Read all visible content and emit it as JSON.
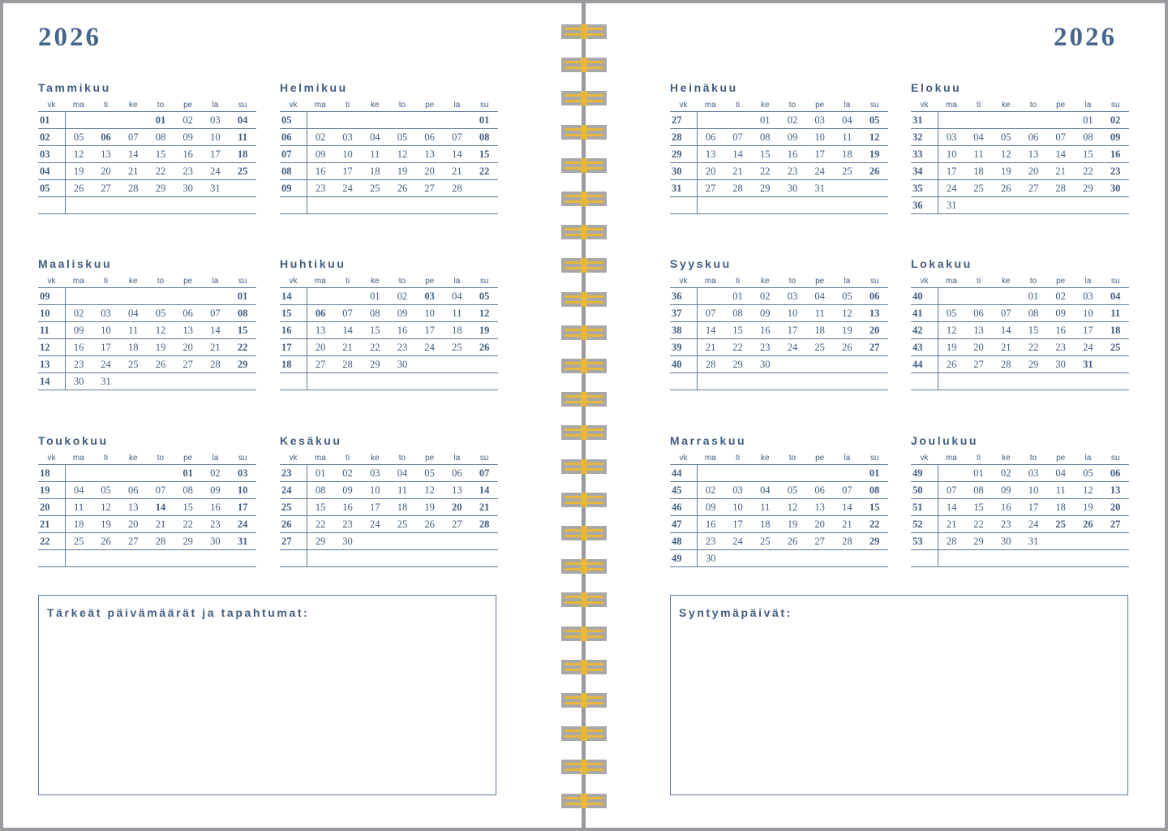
{
  "year": "2026",
  "weekday_headers": [
    "vk",
    "ma",
    "ti",
    "ke",
    "to",
    "pe",
    "la",
    "su"
  ],
  "months": [
    {
      "name": "Tammikuu",
      "rows": [
        {
          "wk": "01",
          "days": [
            "",
            "",
            "",
            "01",
            "02",
            "03",
            "04"
          ],
          "bold": [
            3,
            6
          ]
        },
        {
          "wk": "02",
          "days": [
            "05",
            "06",
            "07",
            "08",
            "09",
            "10",
            "11"
          ],
          "bold": [
            1,
            6
          ]
        },
        {
          "wk": "03",
          "days": [
            "12",
            "13",
            "14",
            "15",
            "16",
            "17",
            "18"
          ],
          "bold": [
            6
          ]
        },
        {
          "wk": "04",
          "days": [
            "19",
            "20",
            "21",
            "22",
            "23",
            "24",
            "25"
          ],
          "bold": [
            6
          ]
        },
        {
          "wk": "05",
          "days": [
            "26",
            "27",
            "28",
            "29",
            "30",
            "31",
            ""
          ],
          "bold": []
        },
        {
          "wk": "",
          "days": [
            "",
            "",
            "",
            "",
            "",
            "",
            ""
          ],
          "bold": []
        }
      ]
    },
    {
      "name": "Helmikuu",
      "rows": [
        {
          "wk": "05",
          "days": [
            "",
            "",
            "",
            "",
            "",
            "",
            "01"
          ],
          "bold": [
            6
          ]
        },
        {
          "wk": "06",
          "days": [
            "02",
            "03",
            "04",
            "05",
            "06",
            "07",
            "08"
          ],
          "bold": [
            6
          ]
        },
        {
          "wk": "07",
          "days": [
            "09",
            "10",
            "11",
            "12",
            "13",
            "14",
            "15"
          ],
          "bold": [
            6
          ]
        },
        {
          "wk": "08",
          "days": [
            "16",
            "17",
            "18",
            "19",
            "20",
            "21",
            "22"
          ],
          "bold": [
            6
          ]
        },
        {
          "wk": "09",
          "days": [
            "23",
            "24",
            "25",
            "26",
            "27",
            "28",
            ""
          ],
          "bold": []
        },
        {
          "wk": "",
          "days": [
            "",
            "",
            "",
            "",
            "",
            "",
            ""
          ],
          "bold": []
        }
      ]
    },
    {
      "name": "Maaliskuu",
      "rows": [
        {
          "wk": "09",
          "days": [
            "",
            "",
            "",
            "",
            "",
            "",
            "01"
          ],
          "bold": [
            6
          ]
        },
        {
          "wk": "10",
          "days": [
            "02",
            "03",
            "04",
            "05",
            "06",
            "07",
            "08"
          ],
          "bold": [
            6
          ]
        },
        {
          "wk": "11",
          "days": [
            "09",
            "10",
            "11",
            "12",
            "13",
            "14",
            "15"
          ],
          "bold": [
            6
          ]
        },
        {
          "wk": "12",
          "days": [
            "16",
            "17",
            "18",
            "19",
            "20",
            "21",
            "22"
          ],
          "bold": [
            6
          ]
        },
        {
          "wk": "13",
          "days": [
            "23",
            "24",
            "25",
            "26",
            "27",
            "28",
            "29"
          ],
          "bold": [
            6
          ]
        },
        {
          "wk": "14",
          "days": [
            "30",
            "31",
            "",
            "",
            "",
            "",
            ""
          ],
          "bold": []
        }
      ]
    },
    {
      "name": "Huhtikuu",
      "rows": [
        {
          "wk": "14",
          "days": [
            "",
            "",
            "01",
            "02",
            "03",
            "04",
            "05"
          ],
          "bold": [
            4,
            6
          ]
        },
        {
          "wk": "15",
          "days": [
            "06",
            "07",
            "08",
            "09",
            "10",
            "11",
            "12"
          ],
          "bold": [
            0,
            6
          ]
        },
        {
          "wk": "16",
          "days": [
            "13",
            "14",
            "15",
            "16",
            "17",
            "18",
            "19"
          ],
          "bold": [
            6
          ]
        },
        {
          "wk": "17",
          "days": [
            "20",
            "21",
            "22",
            "23",
            "24",
            "25",
            "26"
          ],
          "bold": [
            6
          ]
        },
        {
          "wk": "18",
          "days": [
            "27",
            "28",
            "29",
            "30",
            "",
            "",
            ""
          ],
          "bold": []
        },
        {
          "wk": "",
          "days": [
            "",
            "",
            "",
            "",
            "",
            "",
            ""
          ],
          "bold": []
        }
      ]
    },
    {
      "name": "Toukokuu",
      "rows": [
        {
          "wk": "18",
          "days": [
            "",
            "",
            "",
            "",
            "01",
            "02",
            "03"
          ],
          "bold": [
            4,
            6
          ]
        },
        {
          "wk": "19",
          "days": [
            "04",
            "05",
            "06",
            "07",
            "08",
            "09",
            "10"
          ],
          "bold": [
            6
          ]
        },
        {
          "wk": "20",
          "days": [
            "11",
            "12",
            "13",
            "14",
            "15",
            "16",
            "17"
          ],
          "bold": [
            3,
            6
          ]
        },
        {
          "wk": "21",
          "days": [
            "18",
            "19",
            "20",
            "21",
            "22",
            "23",
            "24"
          ],
          "bold": [
            6
          ]
        },
        {
          "wk": "22",
          "days": [
            "25",
            "26",
            "27",
            "28",
            "29",
            "30",
            "31"
          ],
          "bold": [
            6
          ]
        },
        {
          "wk": "",
          "days": [
            "",
            "",
            "",
            "",
            "",
            "",
            ""
          ],
          "bold": []
        }
      ]
    },
    {
      "name": "Kesäkuu",
      "rows": [
        {
          "wk": "23",
          "days": [
            "01",
            "02",
            "03",
            "04",
            "05",
            "06",
            "07"
          ],
          "bold": [
            6
          ]
        },
        {
          "wk": "24",
          "days": [
            "08",
            "09",
            "10",
            "11",
            "12",
            "13",
            "14"
          ],
          "bold": [
            6
          ]
        },
        {
          "wk": "25",
          "days": [
            "15",
            "16",
            "17",
            "18",
            "19",
            "20",
            "21"
          ],
          "bold": [
            5,
            6
          ]
        },
        {
          "wk": "26",
          "days": [
            "22",
            "23",
            "24",
            "25",
            "26",
            "27",
            "28"
          ],
          "bold": [
            6
          ]
        },
        {
          "wk": "27",
          "days": [
            "29",
            "30",
            "",
            "",
            "",
            "",
            ""
          ],
          "bold": []
        },
        {
          "wk": "",
          "days": [
            "",
            "",
            "",
            "",
            "",
            "",
            ""
          ],
          "bold": []
        }
      ]
    },
    {
      "name": "Heinäkuu",
      "rows": [
        {
          "wk": "27",
          "days": [
            "",
            "",
            "01",
            "02",
            "03",
            "04",
            "05"
          ],
          "bold": [
            6
          ]
        },
        {
          "wk": "28",
          "days": [
            "06",
            "07",
            "08",
            "09",
            "10",
            "11",
            "12"
          ],
          "bold": [
            6
          ]
        },
        {
          "wk": "29",
          "days": [
            "13",
            "14",
            "15",
            "16",
            "17",
            "18",
            "19"
          ],
          "bold": [
            6
          ]
        },
        {
          "wk": "30",
          "days": [
            "20",
            "21",
            "22",
            "23",
            "24",
            "25",
            "26"
          ],
          "bold": [
            6
          ]
        },
        {
          "wk": "31",
          "days": [
            "27",
            "28",
            "29",
            "30",
            "31",
            "",
            ""
          ],
          "bold": []
        },
        {
          "wk": "",
          "days": [
            "",
            "",
            "",
            "",
            "",
            "",
            ""
          ],
          "bold": []
        }
      ]
    },
    {
      "name": "Elokuu",
      "rows": [
        {
          "wk": "31",
          "days": [
            "",
            "",
            "",
            "",
            "",
            "01",
            "02"
          ],
          "bold": [
            6
          ]
        },
        {
          "wk": "32",
          "days": [
            "03",
            "04",
            "05",
            "06",
            "07",
            "08",
            "09"
          ],
          "bold": [
            6
          ]
        },
        {
          "wk": "33",
          "days": [
            "10",
            "11",
            "12",
            "13",
            "14",
            "15",
            "16"
          ],
          "bold": [
            6
          ]
        },
        {
          "wk": "34",
          "days": [
            "17",
            "18",
            "19",
            "20",
            "21",
            "22",
            "23"
          ],
          "bold": [
            6
          ]
        },
        {
          "wk": "35",
          "days": [
            "24",
            "25",
            "26",
            "27",
            "28",
            "29",
            "30"
          ],
          "bold": [
            6
          ]
        },
        {
          "wk": "36",
          "days": [
            "31",
            "",
            "",
            "",
            "",
            "",
            ""
          ],
          "bold": []
        }
      ]
    },
    {
      "name": "Syyskuu",
      "rows": [
        {
          "wk": "36",
          "days": [
            "",
            "01",
            "02",
            "03",
            "04",
            "05",
            "06"
          ],
          "bold": [
            6
          ]
        },
        {
          "wk": "37",
          "days": [
            "07",
            "08",
            "09",
            "10",
            "11",
            "12",
            "13"
          ],
          "bold": [
            6
          ]
        },
        {
          "wk": "38",
          "days": [
            "14",
            "15",
            "16",
            "17",
            "18",
            "19",
            "20"
          ],
          "bold": [
            6
          ]
        },
        {
          "wk": "39",
          "days": [
            "21",
            "22",
            "23",
            "24",
            "25",
            "26",
            "27"
          ],
          "bold": [
            6
          ]
        },
        {
          "wk": "40",
          "days": [
            "28",
            "29",
            "30",
            "",
            "",
            "",
            ""
          ],
          "bold": []
        },
        {
          "wk": "",
          "days": [
            "",
            "",
            "",
            "",
            "",
            "",
            ""
          ],
          "bold": []
        }
      ]
    },
    {
      "name": "Lokakuu",
      "rows": [
        {
          "wk": "40",
          "days": [
            "",
            "",
            "",
            "01",
            "02",
            "03",
            "04"
          ],
          "bold": [
            6
          ]
        },
        {
          "wk": "41",
          "days": [
            "05",
            "06",
            "07",
            "08",
            "09",
            "10",
            "11"
          ],
          "bold": [
            6
          ]
        },
        {
          "wk": "42",
          "days": [
            "12",
            "13",
            "14",
            "15",
            "16",
            "17",
            "18"
          ],
          "bold": [
            6
          ]
        },
        {
          "wk": "43",
          "days": [
            "19",
            "20",
            "21",
            "22",
            "23",
            "24",
            "25"
          ],
          "bold": [
            6
          ]
        },
        {
          "wk": "44",
          "days": [
            "26",
            "27",
            "28",
            "29",
            "30",
            "31",
            ""
          ],
          "bold": [
            5
          ]
        },
        {
          "wk": "",
          "days": [
            "",
            "",
            "",
            "",
            "",
            "",
            ""
          ],
          "bold": []
        }
      ]
    },
    {
      "name": "Marraskuu",
      "rows": [
        {
          "wk": "44",
          "days": [
            "",
            "",
            "",
            "",
            "",
            "",
            "01"
          ],
          "bold": [
            6
          ]
        },
        {
          "wk": "45",
          "days": [
            "02",
            "03",
            "04",
            "05",
            "06",
            "07",
            "08"
          ],
          "bold": [
            6
          ]
        },
        {
          "wk": "46",
          "days": [
            "09",
            "10",
            "11",
            "12",
            "13",
            "14",
            "15"
          ],
          "bold": [
            6
          ]
        },
        {
          "wk": "47",
          "days": [
            "16",
            "17",
            "18",
            "19",
            "20",
            "21",
            "22"
          ],
          "bold": [
            6
          ]
        },
        {
          "wk": "48",
          "days": [
            "23",
            "24",
            "25",
            "26",
            "27",
            "28",
            "29"
          ],
          "bold": [
            6
          ]
        },
        {
          "wk": "49",
          "days": [
            "30",
            "",
            "",
            "",
            "",
            "",
            ""
          ],
          "bold": []
        }
      ]
    },
    {
      "name": "Joulukuu",
      "rows": [
        {
          "wk": "49",
          "days": [
            "",
            "01",
            "02",
            "03",
            "04",
            "05",
            "06"
          ],
          "bold": [
            6
          ]
        },
        {
          "wk": "50",
          "days": [
            "07",
            "08",
            "09",
            "10",
            "11",
            "12",
            "13"
          ],
          "bold": [
            6
          ]
        },
        {
          "wk": "51",
          "days": [
            "14",
            "15",
            "16",
            "17",
            "18",
            "19",
            "20"
          ],
          "bold": [
            6
          ]
        },
        {
          "wk": "52",
          "days": [
            "21",
            "22",
            "23",
            "24",
            "25",
            "26",
            "27"
          ],
          "bold": [
            4,
            5,
            6
          ]
        },
        {
          "wk": "53",
          "days": [
            "28",
            "29",
            "30",
            "31",
            "",
            "",
            ""
          ],
          "bold": []
        },
        {
          "wk": "",
          "days": [
            "",
            "",
            "",
            "",
            "",
            "",
            ""
          ],
          "bold": []
        }
      ]
    }
  ],
  "notes_left_title": "Tärkeät päivämäärät ja tapahtumat:",
  "notes_right_title": "Syntymäpäivät:",
  "colors": {
    "text": "#3f5d7f",
    "frame": "#9a9aa0",
    "ring_gold": "#e6b73a",
    "ring_gray": "#a8a8a8"
  }
}
